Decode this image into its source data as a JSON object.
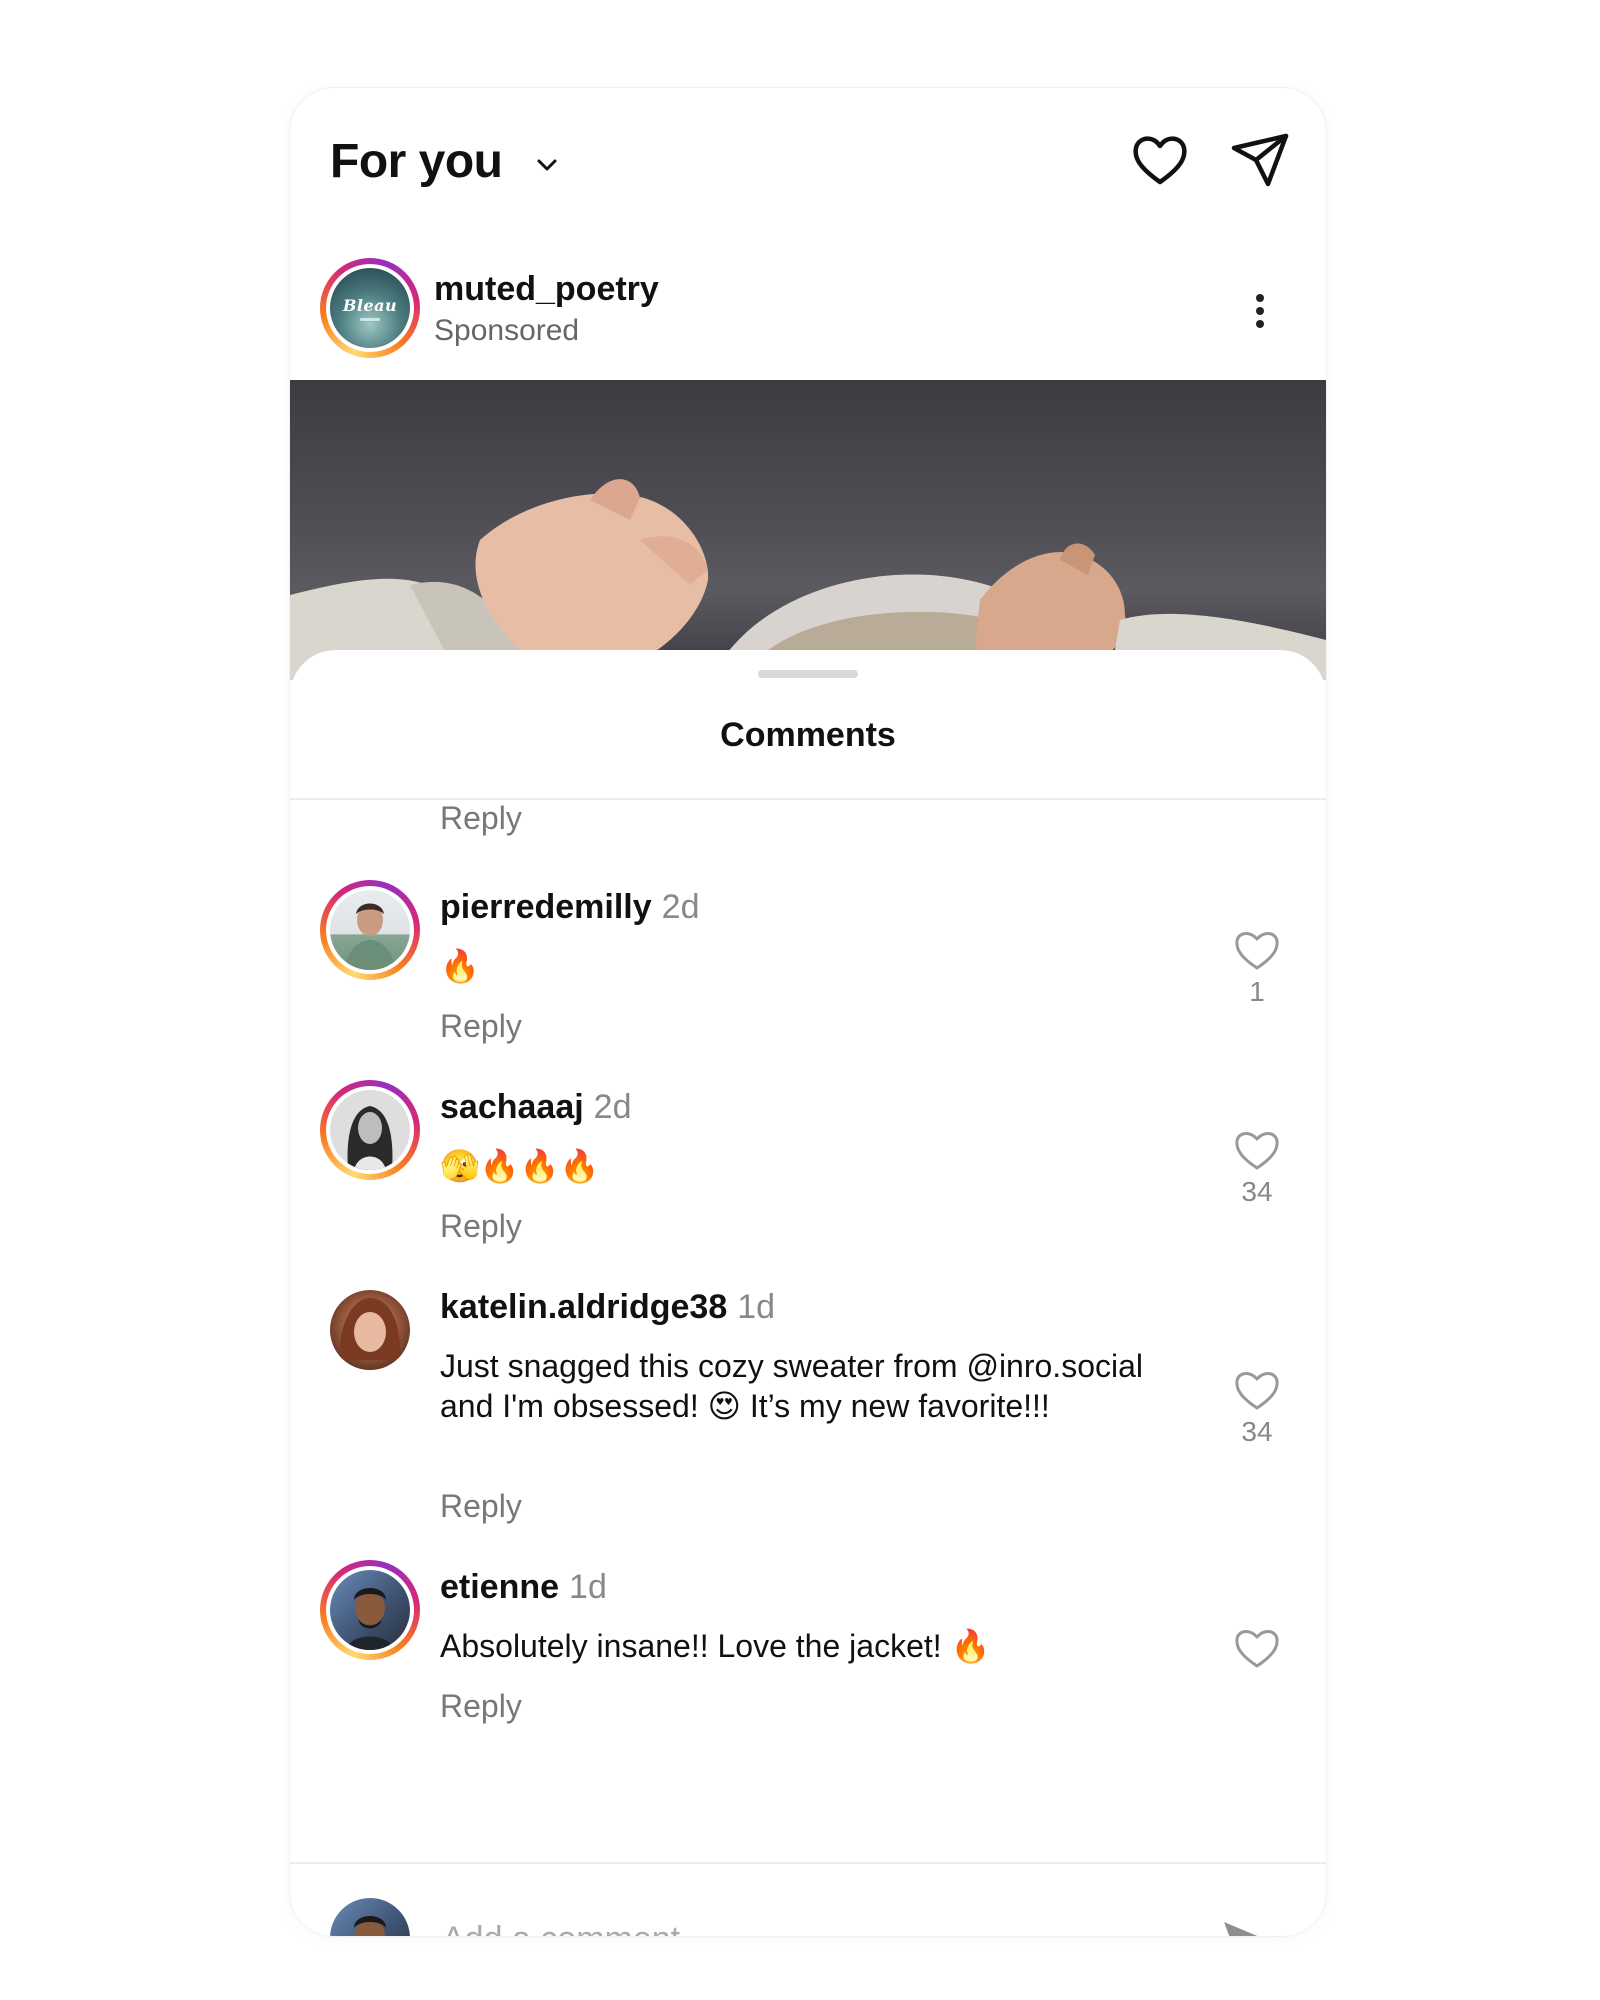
{
  "header": {
    "feed_title": "For you",
    "icons": [
      "chevron-down-icon",
      "heart-icon",
      "send-icon"
    ]
  },
  "post": {
    "username": "muted_poetry",
    "subtitle": "Sponsored",
    "avatar_text": "Bleau"
  },
  "comments_sheet": {
    "title": "Comments",
    "top_reply_label": "Reply",
    "comments": [
      {
        "username": "pierredemilly",
        "time": "2d",
        "text": "🔥",
        "reply_label": "Reply",
        "likes": "1"
      },
      {
        "username": "sachaaaj",
        "time": "2d",
        "text": "🫣🔥🔥🔥",
        "reply_label": "Reply",
        "likes": "34"
      },
      {
        "username": "katelin.aldridge38",
        "time": "1d",
        "text": "Just snagged this cozy sweater from @inro.social and I'm obsessed! 😍 It’s my new favorite!!!",
        "reply_label": "Reply",
        "likes": "34"
      },
      {
        "username": "etienne",
        "time": "1d",
        "text": "Absolutely insane!! Love the jacket! 🔥",
        "reply_label": "Reply",
        "likes": ""
      }
    ]
  },
  "composer": {
    "placeholder": "Add a comment..."
  },
  "colors": {
    "story_ring": [
      "#feda75",
      "#fa7e1e",
      "#d62976",
      "#962fbf"
    ],
    "muted_text": "#777777"
  }
}
